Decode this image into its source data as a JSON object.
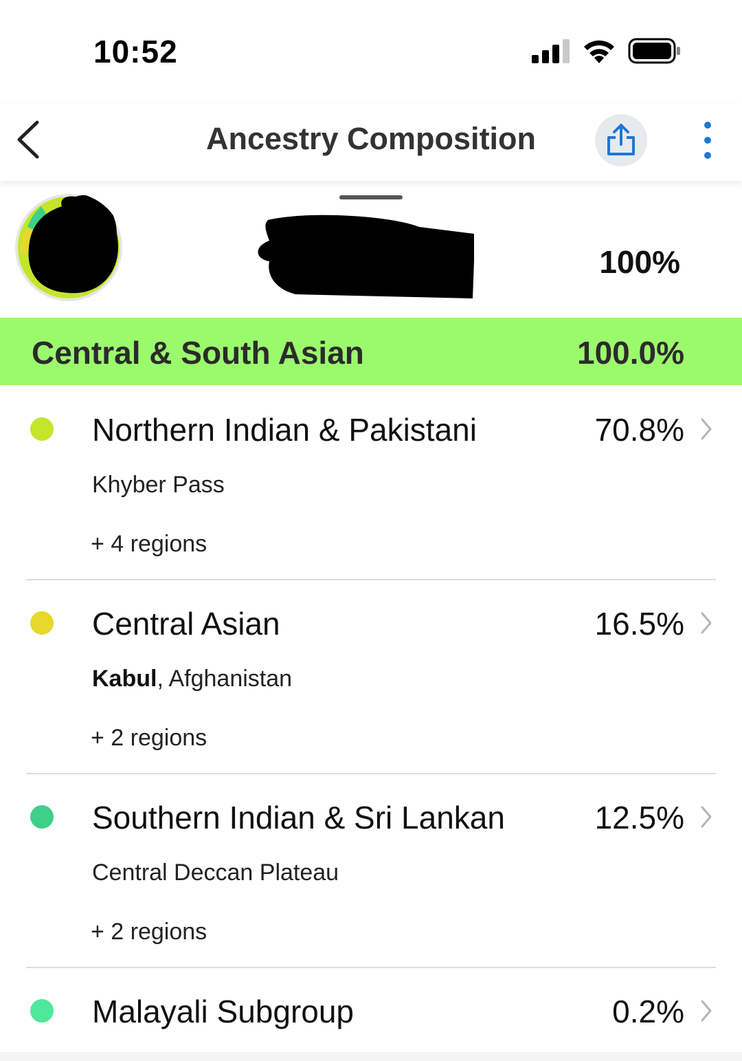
{
  "status_bar": {
    "time": "10:52"
  },
  "nav": {
    "title": "Ancestry Composition",
    "share_icon": "share-icon",
    "more_icon": "more-vertical-icon",
    "back_icon": "chevron-left-icon"
  },
  "profile": {
    "total_percent": "100%"
  },
  "category": {
    "label": "Central & South Asian",
    "value": "100.0%",
    "color": "#9bf96c"
  },
  "rows": [
    {
      "name": "Northern Indian & Pakistani",
      "value": "70.8%",
      "region_bold": "",
      "region_rest": "Khyber Pass",
      "more": "+ 4 regions",
      "color": "#c3e62a"
    },
    {
      "name": "Central Asian",
      "value": "16.5%",
      "region_bold": "Kabul",
      "region_rest": ", Afghanistan",
      "more": "+ 2 regions",
      "color": "#e6d92c"
    },
    {
      "name": "Southern Indian & Sri Lankan",
      "value": "12.5%",
      "region_bold": "",
      "region_rest": "Central Deccan Plateau",
      "more": "+ 2 regions",
      "color": "#3ed08a"
    },
    {
      "name": "Malayali Subgroup",
      "value": "0.2%",
      "color": "#4fe79a"
    }
  ]
}
